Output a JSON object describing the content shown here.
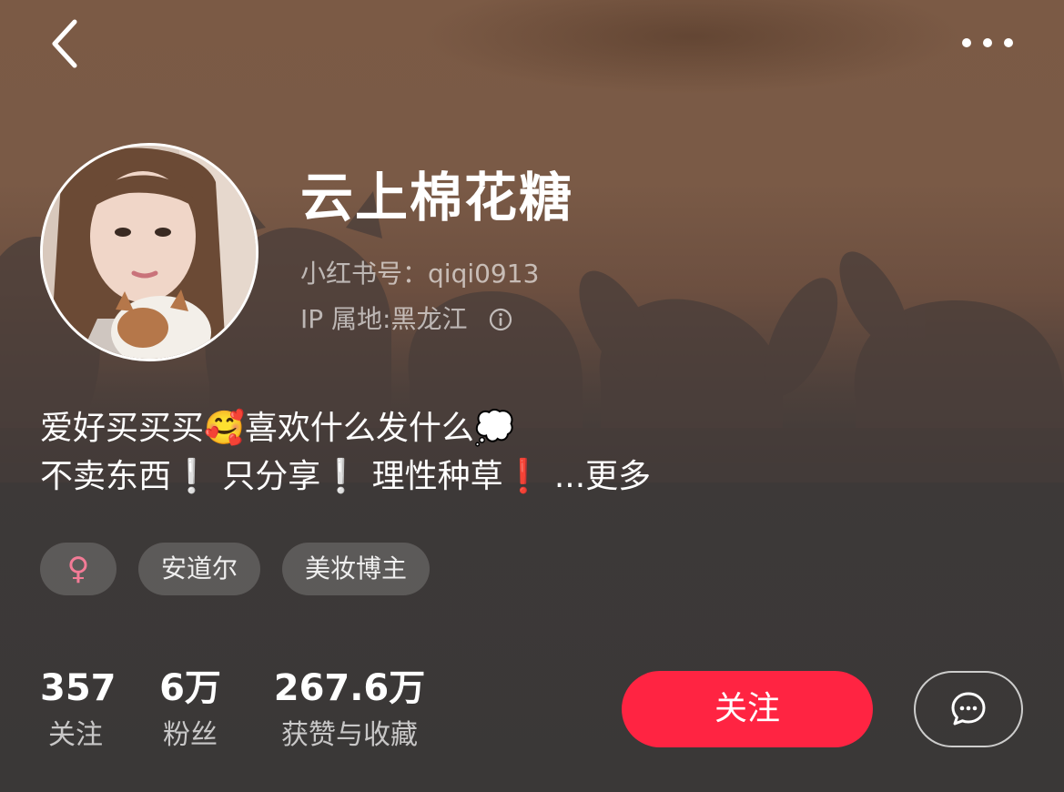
{
  "header": {
    "back_icon": "chevron-left-icon",
    "more_icon": "more-dots-icon"
  },
  "profile": {
    "name": "云上棉花糖",
    "id_label": "小红书号：",
    "id_value": "qiqi0913",
    "ip_label": "IP 属地: ",
    "ip_value": "黑龙江",
    "info_icon": "info-circle-icon",
    "avatar_icon": "avatar-photo"
  },
  "bio": {
    "line1_text": "爱好买买买",
    "line1_emoji": "🥰",
    "line1_text2": "喜欢什么发什么",
    "line1_emoji2": "💭",
    "line2_seg1": "不卖东西",
    "line2_ex1": "❕",
    "line2_seg2": " 只分享",
    "line2_ex2": "❕",
    "line2_seg3": " 理性种草",
    "line2_ex3": "❗",
    "more_label": " ...更多"
  },
  "tags": {
    "gender": "♀",
    "location": "安道尔",
    "category": "美妆博主"
  },
  "stats": {
    "following": {
      "value": "357",
      "label": "关注"
    },
    "followers": {
      "value": "6万",
      "label": "粉丝"
    },
    "likes": {
      "value": "267.6万",
      "label": "获赞与收藏"
    }
  },
  "actions": {
    "follow_label": "关注",
    "message_icon": "chat-bubble-icon"
  },
  "colors": {
    "accent": "#ff2442",
    "gender_pink": "#f27b96",
    "bg_top": "#7b5a45",
    "bg_bottom": "#3a3837"
  }
}
